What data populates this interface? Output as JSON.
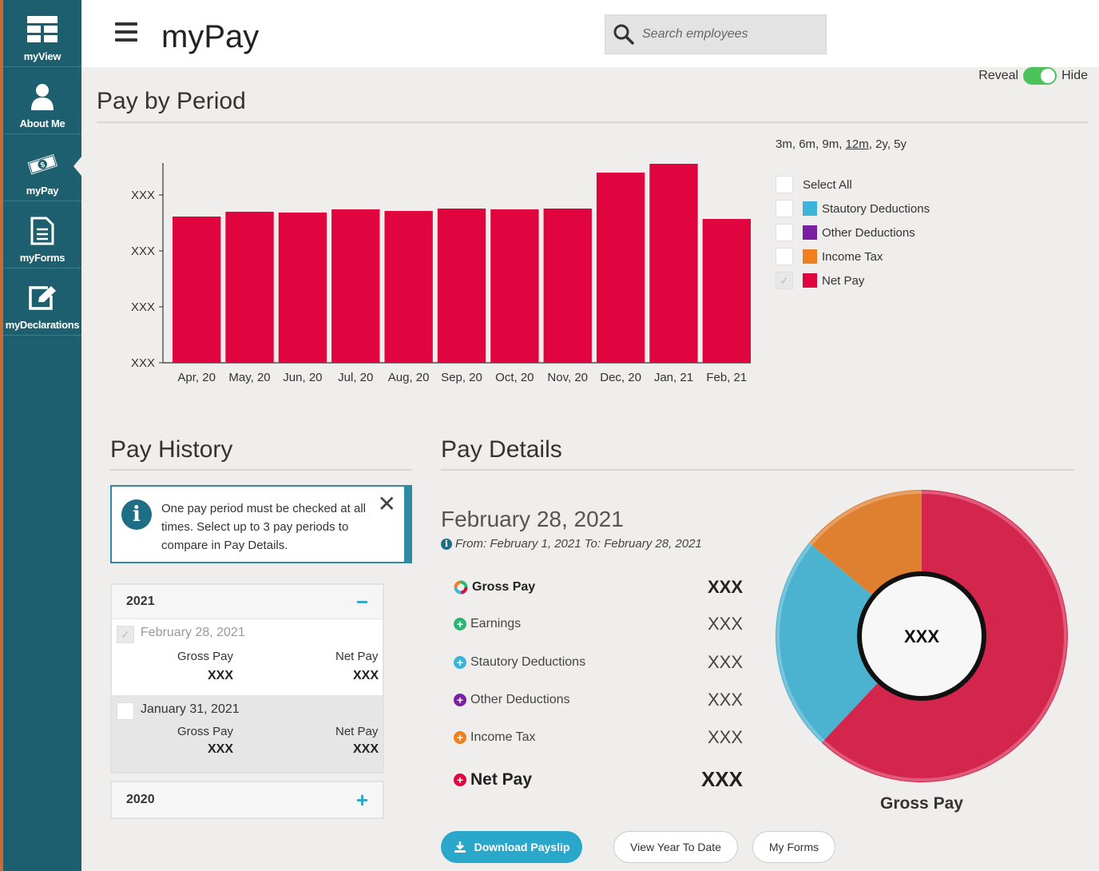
{
  "app": {
    "title": "myPay"
  },
  "sidebar": {
    "items": [
      {
        "label": "myView",
        "icon": "grid-icon"
      },
      {
        "label": "About Me",
        "icon": "person-icon"
      },
      {
        "label": "myPay",
        "icon": "money-icon",
        "active": true
      },
      {
        "label": "myForms",
        "icon": "document-icon"
      },
      {
        "label": "myDeclarations",
        "icon": "edit-icon"
      }
    ]
  },
  "header": {
    "search_placeholder": "Search employees"
  },
  "reveal": {
    "reveal_label": "Reveal",
    "hide_label": "Hide",
    "state": "hide"
  },
  "pay_by_period": {
    "title": "Pay by Period",
    "ranges": [
      "3m",
      "6m",
      "9m",
      "12m",
      "2y",
      "5y"
    ],
    "selected_range": "12m",
    "legend": [
      {
        "label": "Select All",
        "checked": false,
        "color": ""
      },
      {
        "label": "Stautory Deductions",
        "checked": false,
        "color": "#3ab4d9"
      },
      {
        "label": "Other Deductions",
        "checked": false,
        "color": "#7a1fa2"
      },
      {
        "label": "Income Tax",
        "checked": false,
        "color": "#f07f1f"
      },
      {
        "label": "Net Pay",
        "checked": true,
        "color": "#e0053f"
      }
    ]
  },
  "chart_data": {
    "type": "bar",
    "categories": [
      "Apr, 20",
      "May, 20",
      "Jun, 20",
      "Jul, 20",
      "Aug, 20",
      "Sep, 20",
      "Oct, 20",
      "Nov, 20",
      "Dec, 20",
      "Jan, 21",
      "Feb, 21"
    ],
    "series": [
      {
        "name": "Net Pay",
        "values": [
          183,
          189,
          188,
          192,
          190,
          193,
          192,
          193,
          238,
          249,
          180
        ],
        "color": "#e0053f"
      }
    ],
    "y_tick_labels": [
      "XXX",
      "XXX",
      "XXX",
      "XXX"
    ],
    "y_ticks": [
      0,
      70,
      140,
      210
    ],
    "ylim": [
      0,
      250
    ],
    "note": "values estimated relative to bar height; y axis values masked as XXX",
    "grid": false
  },
  "pay_history": {
    "title": "Pay History",
    "info_text": "One pay period must be checked at all times. Select up to 3 pay periods to compare in Pay Details.",
    "years": [
      {
        "year": "2021",
        "expanded": true,
        "toggle": "−",
        "periods": [
          {
            "date": "February 28, 2021",
            "checked": true,
            "gross_label": "Gross Pay",
            "gross": "XXX",
            "net_label": "Net Pay",
            "net": "XXX"
          },
          {
            "date": "January 31, 2021",
            "checked": false,
            "gross_label": "Gross Pay",
            "gross": "XXX",
            "net_label": "Net Pay",
            "net": "XXX"
          }
        ]
      },
      {
        "year": "2020",
        "expanded": false,
        "toggle": "+"
      }
    ]
  },
  "pay_details": {
    "title": "Pay Details",
    "date": "February 28, 2021",
    "range": "From: February 1, 2021 To: February 28, 2021",
    "rows": [
      {
        "label": "Gross Pay",
        "amount": "XXX",
        "color": "#e0053f"
      },
      {
        "label": "Earnings",
        "amount": "XXX",
        "color": "#2bb673"
      },
      {
        "label": "Stautory Deductions",
        "amount": "XXX",
        "color": "#3ab4d9"
      },
      {
        "label": "Other Deductions",
        "amount": "XXX",
        "color": "#7a1fa2"
      },
      {
        "label": "Income Tax",
        "amount": "XXX",
        "color": "#f07f1f"
      },
      {
        "label": "Net Pay",
        "amount": "XXX",
        "color": "#e0053f"
      }
    ],
    "donut": {
      "center_label": "XXX",
      "caption": "Gross Pay",
      "segments": [
        {
          "name": "Net Pay",
          "fraction": 0.62,
          "color": "#d4254d"
        },
        {
          "name": "Stautory Deductions",
          "fraction": 0.24,
          "color": "#4bb2cf"
        },
        {
          "name": "Income Tax",
          "fraction": 0.14,
          "color": "#df8030"
        }
      ]
    },
    "buttons": {
      "download": "Download Payslip",
      "ytd": "View Year To Date",
      "forms": "My Forms"
    }
  }
}
